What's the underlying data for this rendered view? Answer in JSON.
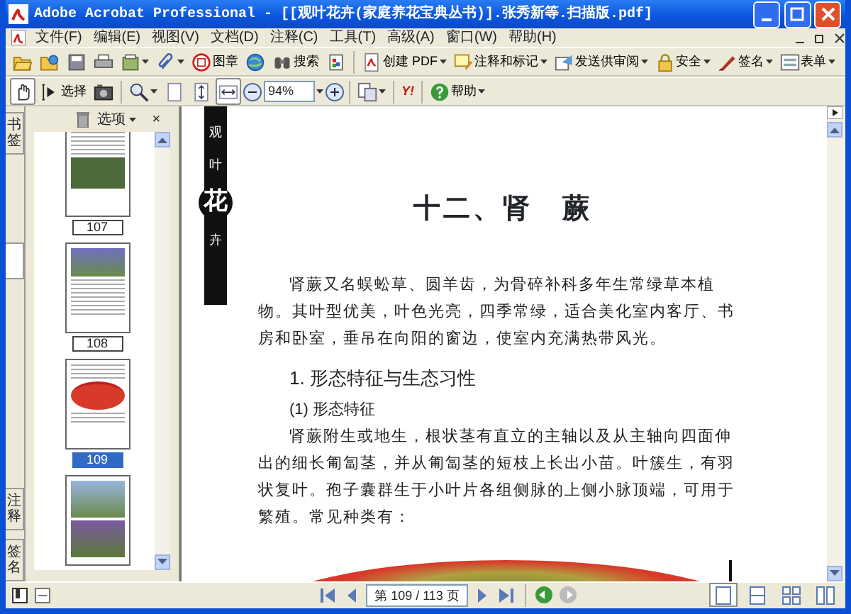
{
  "window": {
    "title": "Adobe Acrobat Professional - [[观叶花卉(家庭养花宝典丛书)].张秀新等.扫描版.pdf]"
  },
  "menu": [
    "文件(F)",
    "编辑(E)",
    "视图(V)",
    "文档(D)",
    "注释(C)",
    "工具(T)",
    "高级(A)",
    "窗口(W)",
    "帮助(H)"
  ],
  "toolbar_1": [
    "图章",
    "搜索",
    "创建 PDF",
    "注释和标记",
    "发送供审阅",
    "安全",
    "签名",
    "表单"
  ],
  "toolbar_2": {
    "tools": [
      {
        "selected": true
      },
      {
        "label": "选择",
        "selected": false
      },
      {
        "selected": false
      }
    ],
    "view_buttons": [
      {
        "selected": false
      },
      {
        "selected": false
      },
      {
        "selected": true
      }
    ],
    "zoom": "94%",
    "search_logo": "Y!",
    "help": "帮助"
  },
  "nav_tabs": [
    {
      "label": "书签",
      "selected": false
    },
    {
      "selected": true
    },
    {
      "label": "注释",
      "selected": false
    },
    {
      "label": "签名",
      "selected": false
    }
  ],
  "panel": {
    "options": "选项",
    "close": "×"
  },
  "thumbnails": [
    {
      "label": "107",
      "selected": false,
      "kind": "bottom-photo"
    },
    {
      "label": "108",
      "selected": false,
      "kind": "top-photo"
    },
    {
      "label": "109",
      "selected": true,
      "kind": "red-photo"
    },
    {
      "selected": false,
      "kind": "two-photos"
    }
  ],
  "document": {
    "side_band": [
      "观",
      "叶",
      "花",
      "卉"
    ],
    "heading": "十二、肾　蕨",
    "blocks": [
      {
        "kind": "body",
        "text": "肾蕨又名蜈蚣草、圆羊齿，为骨碎补科多年生常绿草本植物。其叶型优美，叶色光亮，四季常绿，适合美化室内客厅、书房和卧室，垂吊在向阳的窗边，使室内充满热带风光。"
      },
      {
        "kind": "section",
        "text": "1. 形态特征与生态习性"
      },
      {
        "kind": "subsection",
        "text": "(1) 形态特征"
      },
      {
        "kind": "body",
        "text": "肾蕨附生或地生，根状茎有直立的主轴以及从主轴向四面伸出的细长匍匐茎，并从匍匐茎的短枝上长出小苗。叶簇生，有羽状复叶。孢子囊群生于小叶片各组侧脉的上侧小脉顶端，可用于繁殖。常见种类有："
      }
    ]
  },
  "status_bar": {
    "page": "第 109 / 113 页",
    "layouts": [
      {
        "selected": true
      },
      {
        "selected": false
      },
      {
        "selected": false
      },
      {
        "selected": false
      }
    ]
  }
}
